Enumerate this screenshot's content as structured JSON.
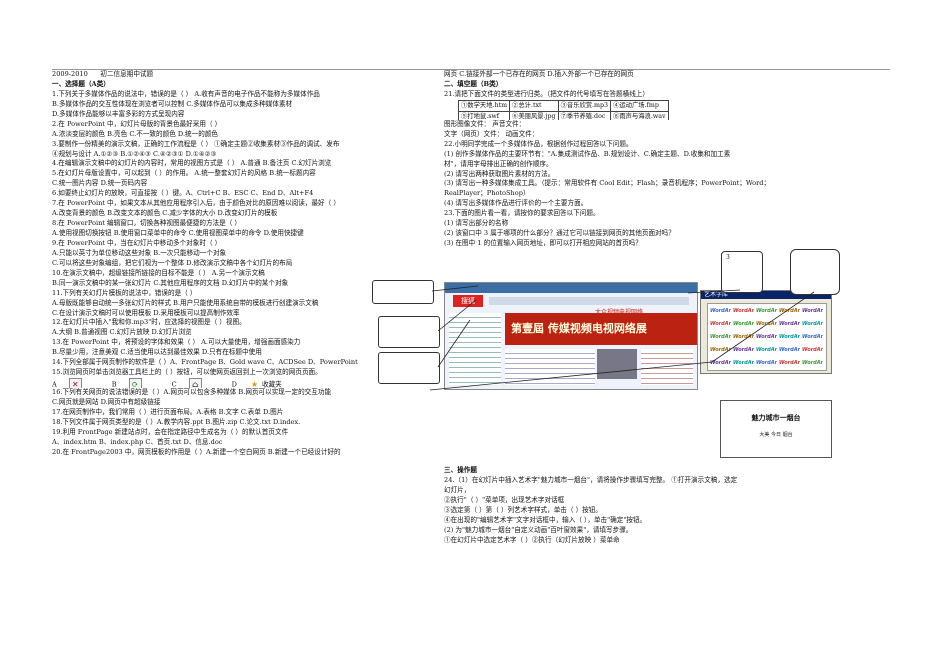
{
  "header": {
    "year": "2009-2010",
    "title": "初二信息期中试题"
  },
  "left_lines": [
    {
      "t": "一、选择题（A类）",
      "sec": true
    },
    {
      "t": "1.下列关于多媒体作品的说法中，错误的是（     ） A.收有声音的电子作品不能称为多媒体作品"
    },
    {
      "t": "B.多媒体作品的交互性体现在浏览者可以控制   C.多媒体作品可以集成多种媒体素材"
    },
    {
      "t": "D.多媒体作品能够以丰富多彩的方式呈现内容"
    },
    {
      "t": "2.在 PowerPoint 中，幻灯片母版的背景色最好采用（     ）"
    },
    {
      "t": "   A.浓淡变层的颜色     B.亮色     C.不一致的颜色     D.统一的颜色"
    },
    {
      "t": "3.要制作一份精美的演示文稿，正确的工作流程是（     ）  ①确定主题②收集素材③作品的调试、发布"
    },
    {
      "t": "   ④规划与设计 A.①②③       B.①②④③       C.④②③①       D.①④②③"
    },
    {
      "t": "4.在编辑演示文稿中的幻灯片的内容时，常用的视图方式是（ ） A.普通  B.备注页  C.幻灯片浏览"
    },
    {
      "t": "5.在幻灯片母版设置中，可以起到（     ）的作用。  A.统一整套幻灯片的风格   B.统一标题内容"
    },
    {
      "t": "   C.统一图片内容     D.统一页码内容"
    },
    {
      "t": "6.如要终止幻灯片的放映，可直接按（     ）键。A、Ctrl+C     B、ESC     C、End     D、Alt+F4"
    },
    {
      "t": "7.在 PowerPoint 中，如果文本从其他应用程序引入后，由于颜色对比的原因难以阅读，最好（     ）"
    },
    {
      "t": "   A.改变背景的颜色     B.改变文本的颜色     C.减少字体的大小     D.改变幻灯片的模板"
    },
    {
      "t": "8.在 PowerPoint 编辑窗口，切换各种视图最便捷的方法是（     ）"
    },
    {
      "t": "   A.使用视图切换按钮     B.使用窗口菜单中的命令     C.使用视图菜单中的命令     D.使用快捷键"
    },
    {
      "t": "9.在 PowerPoint 中，当在幻灯片中移动多个对象时（     ）"
    },
    {
      "t": "   A.只能以英寸为单位移动这些对象     B.一次只能移动一个对象"
    },
    {
      "t": "   C.可以将这些对象编组，把它们视为一个整体     D.修改演示文稿中各个幻灯片的布局"
    },
    {
      "t": "10.在演示文稿中，超级链接所链接的目标不能是（     ） A.另一个演示文稿"
    },
    {
      "t": "   B.同一演示文稿中的某一张幻灯片     C.其他应用程序的文档     D.幻灯片中的某个对象"
    },
    {
      "t": "11.下列有关幻灯片模板的说法中，错误的是（     ）"
    },
    {
      "t": "   A.母版既能够自动统一多张幻灯片的样式     B.用户只能使用系统自带的模板进行创建演示文稿"
    },
    {
      "t": "   C.在设计演示文稿时可以使用模板     D.采用模板可以提高制作效率"
    },
    {
      "t": "12.在幻灯片中插入\"我和你.mp3\"时，应选择的视图是（     ）视图。"
    },
    {
      "t": "   A.大纲     B.普通视图     C.幻灯片放映     D.幻灯片浏览"
    },
    {
      "t": "13.在 PowerPoint 中，将预设的字体和效果（     ） A.可以大量使用，增强画面感染力"
    },
    {
      "t": "   B.尽量少用，注意美观     C.适当使用以达到最佳效果     D.只有在标题中使用"
    },
    {
      "t": "14.下列全部属于网页制作的软件是（     ）A、FrontPage     B、Gold wave     C、ACDSee     D、PowerPoint"
    },
    {
      "t": "15.浏览网页时单击浏览器工具栏上的（     ）按钮，可以使网页返回到上一次浏览的网页页面。"
    },
    {
      "t": "ICONS",
      "icons": true
    },
    {
      "t": "16.下列有关网页的说法错误的是（     ）A.网页可以包含多种媒体     B.网页可以实现一定的交互功能"
    },
    {
      "t": "   C.网页就是网站     D.网页中有超级链接"
    },
    {
      "t": "17.在网页制作中，我们常用（     ）进行页面布局。A.表格     B.文字     C.表单     D.图片"
    },
    {
      "t": "18.下列文件属于网页类型的是（     ）A.教学内容.ppt     B.图片.zip     C.论文.txt     D.index."
    },
    {
      "t": "19.利用 FrontPage 新建站点时，会在指定路径中生成名为（     ）的默认首页文件"
    },
    {
      "t": "   A、index.htm     B、index.php     C、首页.txt     D、信息.doc"
    },
    {
      "t": "20.在 FrontPage2003 中，网页模板的作用是（     ）A.新建一个空白网页     B.新建一个已经设计好的"
    }
  ],
  "icons": [
    {
      "label": "A",
      "icon": "close-red-x-icon"
    },
    {
      "label": "B",
      "icon": "refresh-icon"
    },
    {
      "label": "C",
      "icon": "home-icon"
    },
    {
      "label": "D",
      "icon": "favorites-star-icon",
      "text": "收藏夹"
    }
  ],
  "right_lines": [
    {
      "t": "网页     C.链接外部一个已存在的网页          D.插入外部一个已存在的网页"
    },
    {
      "t": "二、填空题（B类）",
      "sec": true
    },
    {
      "t": "21.请把下面文件的类型进行归类。（把文件的代号填写在答题横线上）"
    },
    {
      "t": "TABLE",
      "table": true
    },
    {
      "t": "TABLE2",
      "spacer": true
    },
    {
      "t": "     图形图像文件：                                      声音文件："
    },
    {
      "t": "     文字（网页）文件：                                  动画文件："
    },
    {
      "t": "22.小明同学完成一个多媒体作品，根据创作过程回答以下问题。"
    },
    {
      "t": "  (1) 创作多媒体作品的主要环节有：\"A.集成测试作品、B.规划设计、C.确定主题、D.收集和加工素"
    },
    {
      "t": "      材\"，请用字母排出正确的创作顺序。"
    },
    {
      "t": "  (2) 请写出两种获取图片素材的方法。"
    },
    {
      "t": "  (3) 请写出一种多媒体集成工具。（提示：常用软件有 Cool Edit；Flash；录音机程序；PowerPoint；Word；"
    },
    {
      "t": "RealPlayer；PhotoShop）"
    },
    {
      "t": "  (4) 请写出多媒体作品进行评价的一个主要方面。"
    },
    {
      "t": "23.下面的图片看一看，请按你的要求回答以下问题。"
    },
    {
      "t": "  (1) 请写出部分的名称"
    },
    {
      "t": "  (2) 该窗口中 3 属于哪项的什么部分？通过它可以链接到网页的其他页面对吗？"
    },
    {
      "t": "  (3) 在图中 1 的位置输入网页地址，即可以打开相应网站的首页吗？"
    }
  ],
  "files_table": [
    [
      "①数学天地.htm",
      "②总计.txt",
      "③音乐欣赏.mp3",
      "④运动广场.fmp"
    ],
    [
      "⑤打地鼠.swf",
      "⑥美丽风景.jpg",
      "⑦季节养殖.doc",
      "⑧雨声与海浪.wav"
    ]
  ],
  "figure": {
    "browser_logo": "搜狐",
    "browser_banner": "第壹屆 传媒视频电视网络展",
    "banner_tag": "大众视频电视网络",
    "callout_label": "3",
    "wordart_title": "艺术字库",
    "wordart_sample": "WordArt",
    "card_title": "魅力城市一烟台",
    "card_sub": "大美  今日  烟台"
  },
  "right_bottom_lines": [
    {
      "t": "三、操作题",
      "sec": true
    },
    {
      "t": "24.（1）在幻灯片中插入艺术字\"魅力城市一烟台\"，请将操作步骤填写完整。 ①打开演示文稿，选定"
    },
    {
      "t": "幻灯片，"
    },
    {
      "t": "②执行\"（          ）\"菜单项，出现艺术字对话框"
    },
    {
      "t": "③选定第（     ）第（     ）列艺术字样式，单击（          ）按钮。"
    },
    {
      "t": "④在出现的\"编辑艺术字\"文字对话框中，输入（                              ），单击\"确定\"按钮。"
    },
    {
      "t": "   (2) 为\"魅力城市一烟台\"自定义动画\"百叶窗效果\"，请填写步骤。"
    },
    {
      "t": "①在幻灯片中选定艺术字（                    ）②执行（幻灯片放映                    ）菜单命"
    }
  ]
}
